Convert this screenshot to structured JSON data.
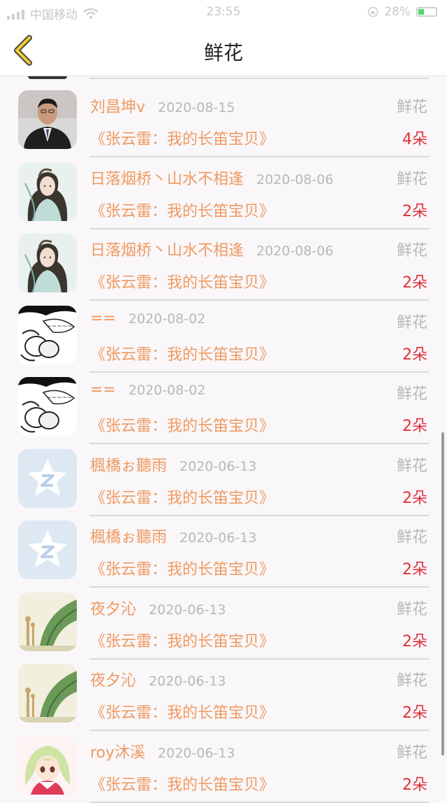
{
  "status": {
    "carrier": "中国移动",
    "time": "23:55",
    "battery": "28%"
  },
  "nav": {
    "title": "鲜花"
  },
  "colors": {
    "name": "#ef9a62",
    "date": "#b8b8b8",
    "count": "#e0303a"
  },
  "gifts": [
    {
      "avatar": "man-suit-avatar",
      "name": "刘昌坤v",
      "date": "2020-08-15",
      "type": "鲜花",
      "title": "《张云雷：我的长笛宝贝》",
      "count": "4朵"
    },
    {
      "avatar": "lady-painting-avatar",
      "name": "日落烟桥丶山水不相逢",
      "date": "2020-08-06",
      "type": "鲜花",
      "title": "《张云雷：我的长笛宝贝》",
      "count": "2朵"
    },
    {
      "avatar": "lady-painting-avatar",
      "name": "日落烟桥丶山水不相逢",
      "date": "2020-08-06",
      "type": "鲜花",
      "title": "《张云雷：我的长笛宝贝》",
      "count": "2朵"
    },
    {
      "avatar": "cartoon-sketch-avatar",
      "name": "==",
      "date": "2020-08-02",
      "type": "鲜花",
      "title": "《张云雷：我的长笛宝贝》",
      "count": "2朵"
    },
    {
      "avatar": "cartoon-sketch-avatar",
      "name": "==",
      "date": "2020-08-02",
      "type": "鲜花",
      "title": "《张云雷：我的长笛宝贝》",
      "count": "2朵"
    },
    {
      "avatar": "qq-default-avatar",
      "name": "楓橋ぉ聽雨",
      "date": "2020-06-13",
      "type": "鲜花",
      "title": "《张云雷：我的长笛宝贝》",
      "count": "2朵"
    },
    {
      "avatar": "qq-default-avatar",
      "name": "楓橋ぉ聽雨",
      "date": "2020-06-13",
      "type": "鲜花",
      "title": "《张云雷：我的长笛宝贝》",
      "count": "2朵"
    },
    {
      "avatar": "leaf-giraffe-avatar",
      "name": "夜夕沁",
      "date": "2020-06-13",
      "type": "鲜花",
      "title": "《张云雷：我的长笛宝贝》",
      "count": "2朵"
    },
    {
      "avatar": "leaf-giraffe-avatar",
      "name": "夜夕沁",
      "date": "2020-06-13",
      "type": "鲜花",
      "title": "《张云雷：我的长笛宝贝》",
      "count": "2朵"
    },
    {
      "avatar": "anime-girl-avatar",
      "name": "roy沐溪",
      "date": "2020-06-13",
      "type": "鲜花",
      "title": "《张云雷：我的长笛宝贝》",
      "count": "2朵"
    }
  ]
}
